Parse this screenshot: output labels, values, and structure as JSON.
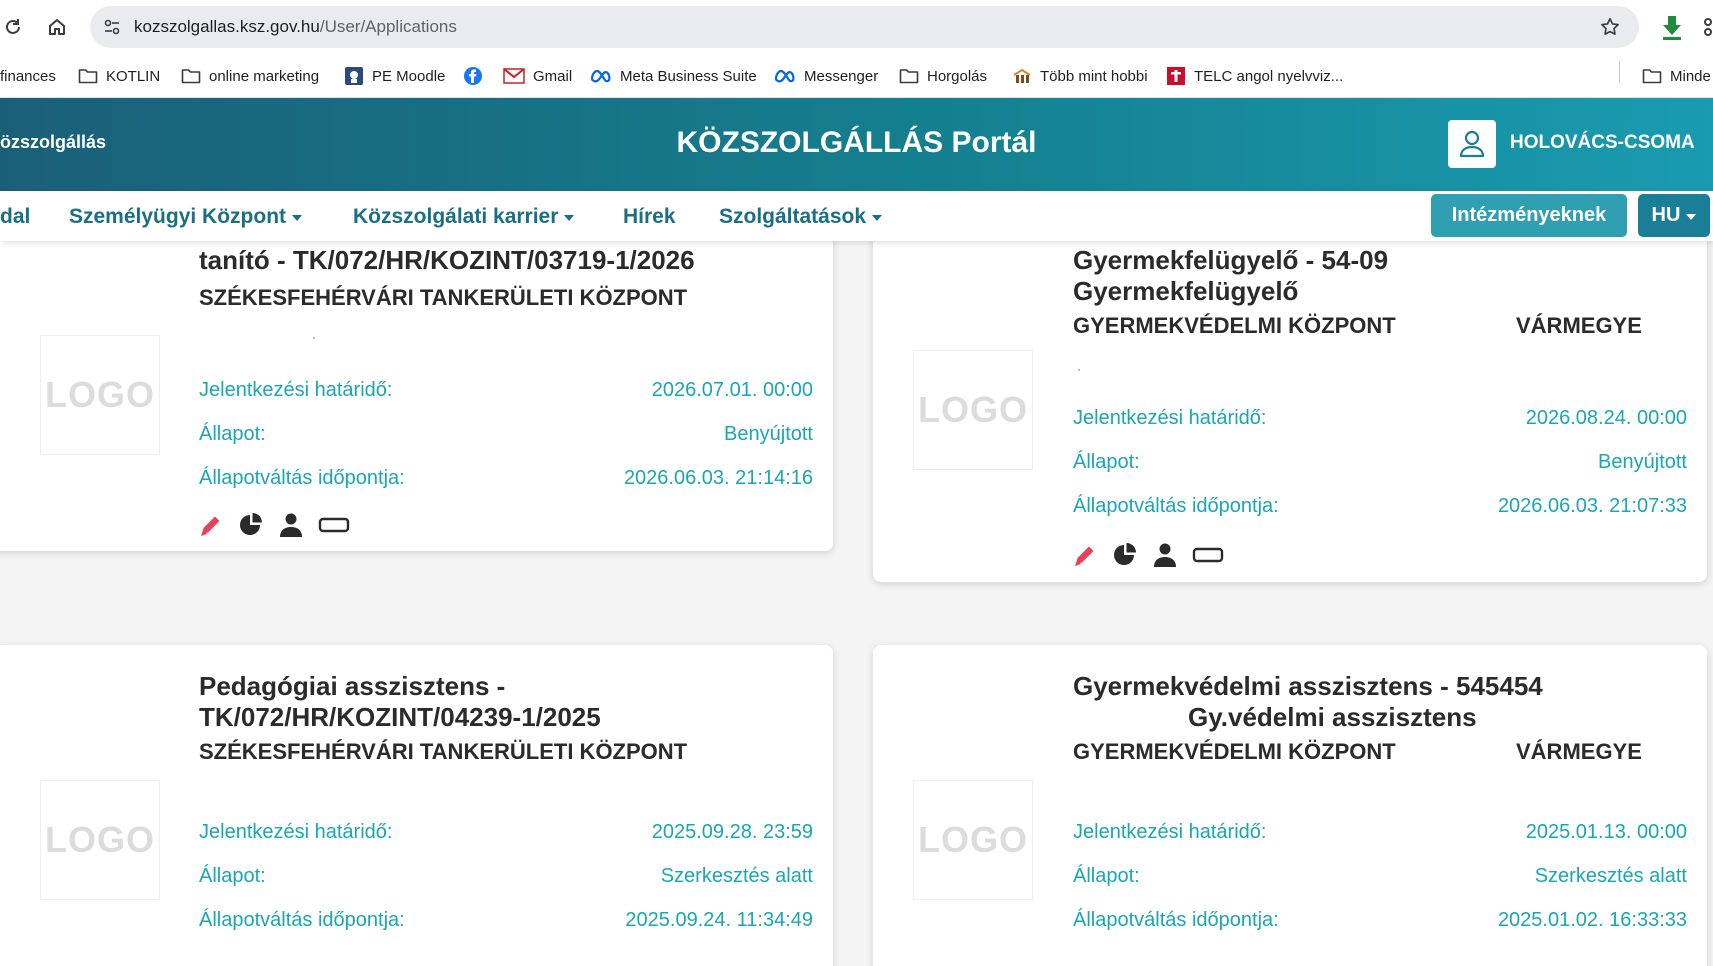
{
  "browser": {
    "url_host": "kozszolgallas.ksz.gov.hu",
    "url_path": "/User/Applications",
    "bookmarks": [
      "finances",
      "KOTLIN",
      "online marketing",
      "PE Moodle",
      "Gmail",
      "Meta Business Suite",
      "Messenger",
      "Horgolás",
      "Több mint hobbi",
      "TELC angol nyelvviz...",
      "Minde"
    ]
  },
  "header": {
    "brand": "özszolgállás",
    "title": "KÖZSZOLGÁLLÁS Portál",
    "user_name": "HOLOVÁCS-CSOMA"
  },
  "nav": {
    "items": [
      "dal",
      "Személyügyi Központ",
      "Közszolgálati karrier",
      "Hírek",
      "Szolgáltatások"
    ],
    "institutions_button": "Intézményeknek",
    "language": "HU"
  },
  "labels": {
    "logo": "LOGO",
    "deadline": "Jelentkezési határidő:",
    "status": "Állapot:",
    "status_changed": "Állapotváltás időpontja:"
  },
  "cards": [
    {
      "title_line1": "tanító - TK/072/HR/KOZINT/03719-1/2026",
      "title_line2": "",
      "employer": "SZÉKESFEHÉRVÁRI TANKERÜLETI KÖZPONT",
      "employer_2": "",
      "deadline": "2026.07.01. 00:00",
      "status": "Benyújtott",
      "status_changed": "2026.06.03. 21:14:16"
    },
    {
      "title_line1": "Gyermekfelügyelő - 54-09",
      "title_line2": "Gyermekfelügyelő",
      "employer": "GYERMEKVÉDELMI KÖZPONT",
      "employer_2": "VÁRMEGYE",
      "deadline": "2026.08.24. 00:00",
      "status": "Benyújtott",
      "status_changed": "2026.06.03. 21:07:33"
    },
    {
      "title_line1": "Pedagógiai asszisztens -",
      "title_line2": "TK/072/HR/KOZINT/04239-1/2025",
      "employer": "SZÉKESFEHÉRVÁRI TANKERÜLETI KÖZPONT",
      "employer_2": "",
      "deadline": "2025.09.28. 23:59",
      "status": "Szerkesztés alatt",
      "status_changed": "2025.09.24. 11:34:49"
    },
    {
      "title_line1": "Gyermekvédelmi asszisztens - 545454",
      "title_line2": "Gy.védelmi asszisztens",
      "employer": "GYERMEKVÉDELMI KÖZPONT",
      "employer_2": "VÁRMEGYE",
      "deadline": "2025.01.13. 00:00",
      "status": "Szerkesztés alatt",
      "status_changed": "2025.01.02. 16:33:33"
    }
  ],
  "icons": [
    "reload-icon",
    "home-icon",
    "site-info-icon",
    "bookmark-star-icon",
    "download-icon",
    "folder-icon",
    "user-icon",
    "edit-pencil-icon",
    "pie-chart-icon",
    "person-icon",
    "badge-icon"
  ],
  "colors": {
    "accent_teal": "#1aa6b2",
    "nav_teal": "#1b6e84",
    "edit_pink": "#e8425a"
  }
}
